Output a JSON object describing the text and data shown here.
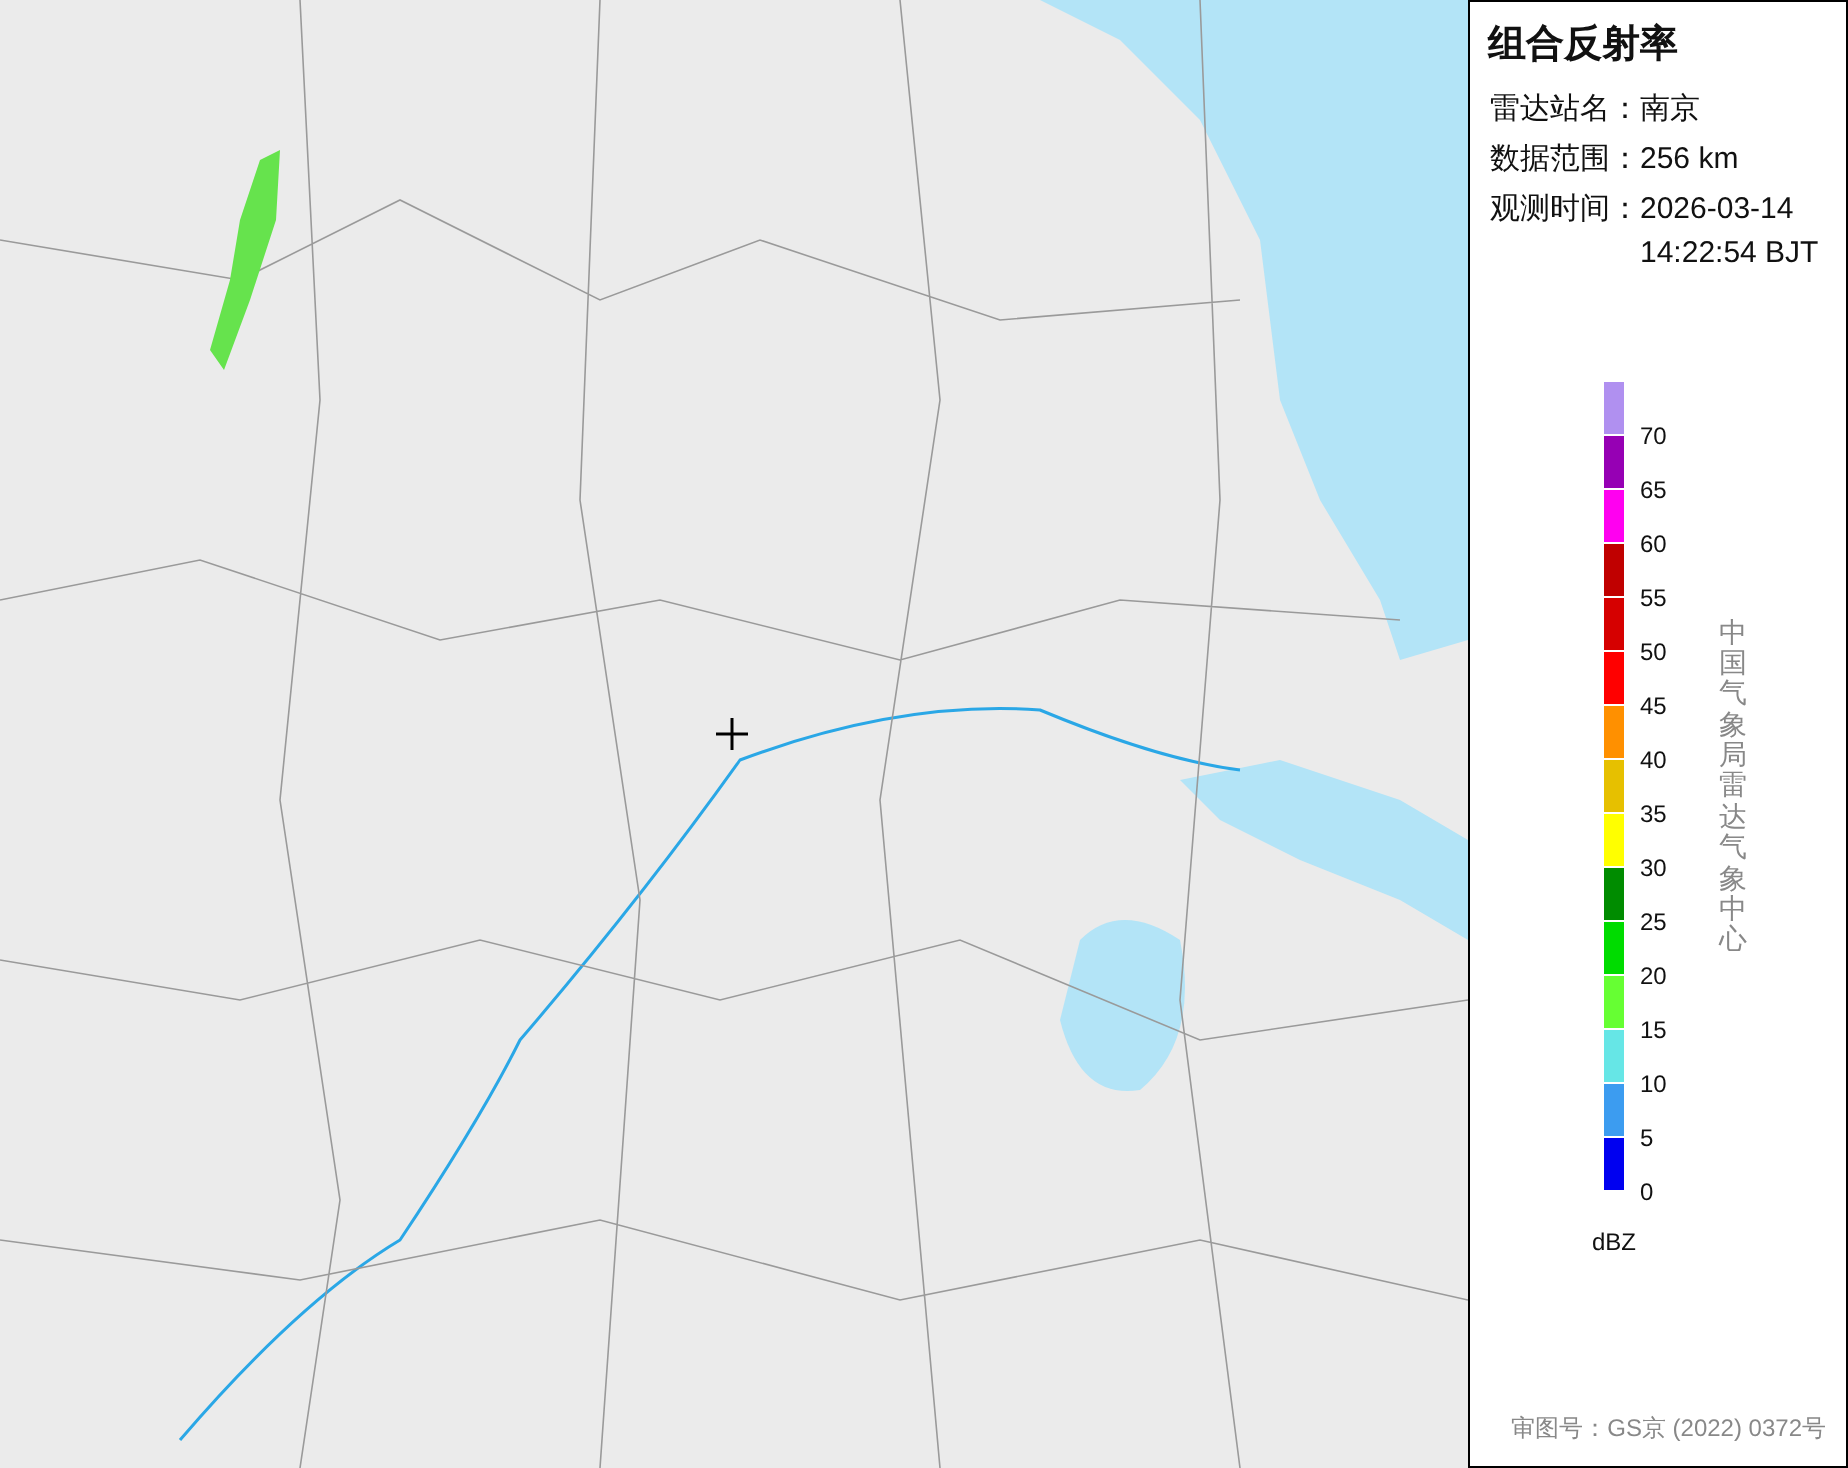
{
  "panel": {
    "title": "组合反射率",
    "fields": [
      {
        "label": "雷达站名：",
        "value": "南京"
      },
      {
        "label": "数据范围：",
        "value": "256 km"
      },
      {
        "label": "观测时间：",
        "value": "2026-03-14 14:22:54 BJT"
      }
    ],
    "legend": {
      "bins": [
        {
          "color": "#b090f0"
        },
        {
          "color": "#9600b4"
        },
        {
          "color": "#ff00f0"
        },
        {
          "color": "#c00000"
        },
        {
          "color": "#d60000"
        },
        {
          "color": "#ff0000"
        },
        {
          "color": "#ff9000"
        },
        {
          "color": "#e6c000"
        },
        {
          "color": "#ffff00"
        },
        {
          "color": "#008c00"
        },
        {
          "color": "#00dc00"
        },
        {
          "color": "#66ff33"
        },
        {
          "color": "#66e6e6"
        },
        {
          "color": "#3c9cf0"
        },
        {
          "color": "#0000f0"
        }
      ],
      "ticks": [
        "70",
        "65",
        "60",
        "55",
        "50",
        "45",
        "40",
        "35",
        "30",
        "25",
        "20",
        "15",
        "10",
        "5",
        "0"
      ],
      "unit": "dBZ"
    },
    "credit": "中国气象局雷达气象中心",
    "approval": "审图号：GS京 (2022) 0372号"
  }
}
